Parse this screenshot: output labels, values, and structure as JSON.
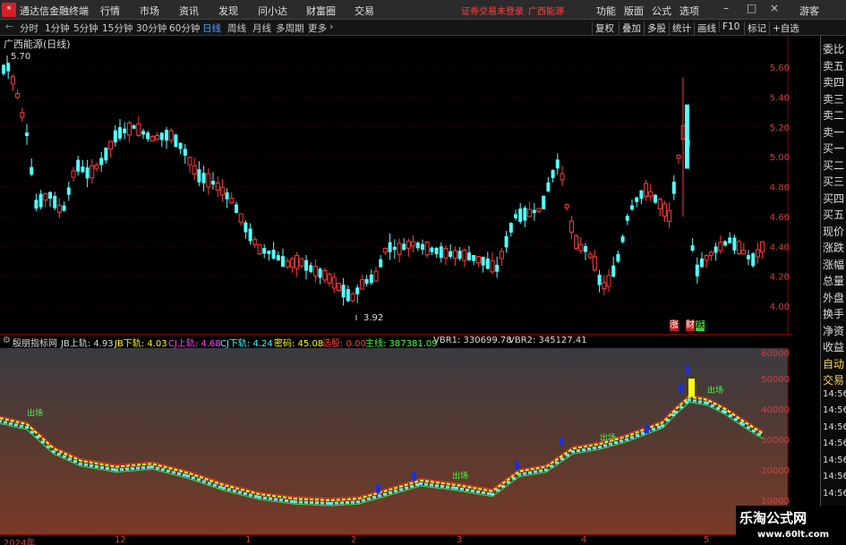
{
  "menubar": {
    "logo_glyph": "ˢ",
    "title": "通达信金融终端",
    "items": [
      "行情",
      "市场",
      "资讯",
      "发现",
      "问小达",
      "财富圈",
      "交易"
    ],
    "login_status": "证券交易未登录",
    "stock_tag": "广西能源",
    "right_items": [
      "功能",
      "版面",
      "公式",
      "选项"
    ],
    "guest": "游客",
    "minimize": "–",
    "maximize": "□",
    "close": "×"
  },
  "periodbar": {
    "periods": [
      "分时",
      "1分钟",
      "5分钟",
      "15分钟",
      "30分钟",
      "60分钟",
      "日线",
      "周线",
      "月线",
      "多周期",
      "更多"
    ],
    "active_period": "日线",
    "more_arrow": "›",
    "tools": [
      "复权",
      "叠加",
      "多股",
      "统计",
      "画线",
      "F10",
      "标记",
      "+自选"
    ],
    "back_arrow": "←"
  },
  "main_chart": {
    "title": "广西能源(日线)",
    "high_label": "5.70",
    "low_label": "3.92",
    "marker_zhang": "涨",
    "marker_cai": "财",
    "marker_die": "跌",
    "y_ticks": [
      "5.60",
      "5.40",
      "5.20",
      "5.00",
      "4.80",
      "4.60",
      "4.40",
      "4.20",
      "4.00"
    ]
  },
  "indicator": {
    "name": "殷朋指标网",
    "items": [
      {
        "text": "JB上轨: 4.93",
        "color": "#dddddd"
      },
      {
        "text": "JB下轨: 4.03",
        "color": "#ffff00"
      },
      {
        "text": "CJ上轨: 4.68",
        "color": "#ff44ff"
      },
      {
        "text": "CJ下轨: 4.24",
        "color": "#44ffff"
      },
      {
        "text": "密码: 45.08",
        "color": "#ffff00"
      },
      {
        "text": "选股: 0.00",
        "color": "#ff4040"
      },
      {
        "text": "主线: 387381.09",
        "color": "#44ff44"
      },
      {
        "text": "VBR1: 330699.78",
        "color": "#dddddd"
      },
      {
        "text": "VBR2: 345127.41",
        "color": "#dddddd"
      }
    ],
    "y_ticks": [
      "60000",
      "50000",
      "40000",
      "30000",
      "20000",
      "10000"
    ],
    "annotations": [
      "出场",
      "出场",
      "出场",
      "出场"
    ]
  },
  "xaxis": {
    "labels": [
      "2024年",
      "12",
      "1",
      "2",
      "3",
      "4",
      "5"
    ]
  },
  "side_panel": {
    "items": [
      "委比",
      "卖五",
      "卖四",
      "卖三",
      "卖二",
      "卖一",
      "买一",
      "买二",
      "买三",
      "买四",
      "买五",
      "现价",
      "涨跌",
      "涨幅",
      "总量",
      "外盘",
      "换手",
      "净资",
      "收益",
      "自动",
      "交易",
      "14:56",
      "14:56",
      "14:56",
      "14:56",
      "14:56",
      "14:56",
      "14:56",
      "14:56"
    ]
  },
  "watermark": {
    "title": "乐淘公式网",
    "url": "www.60lt.com"
  },
  "colors": {
    "up": "#ff3b3b",
    "down": "#54ffff",
    "axis_red": "#8b0000",
    "active_blue": "#4aa3ff"
  }
}
